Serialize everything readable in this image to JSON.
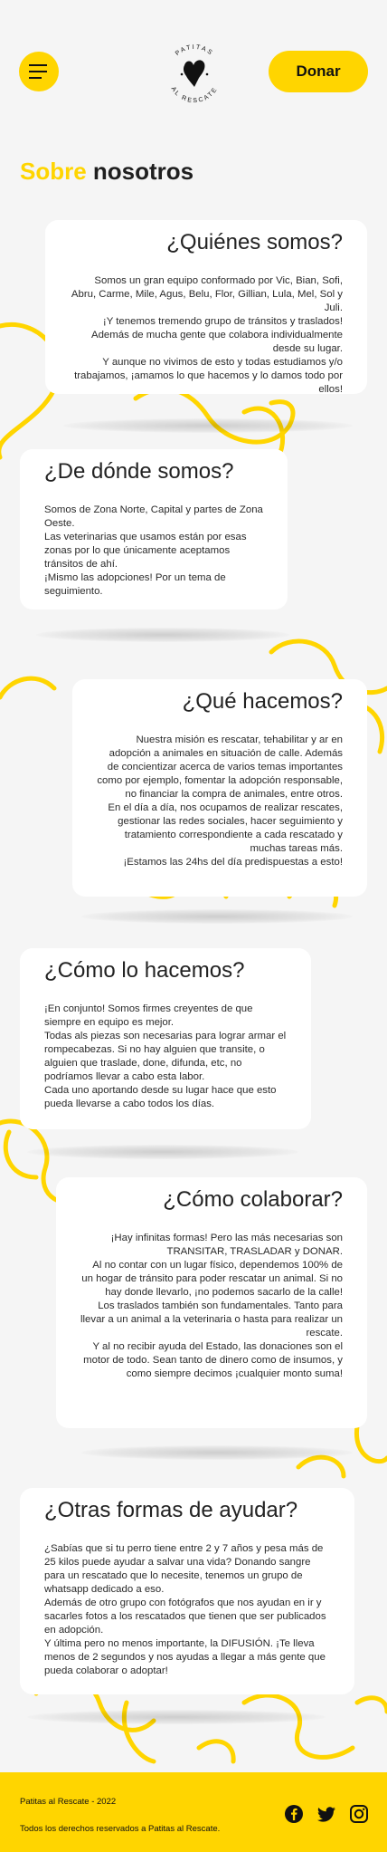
{
  "header": {
    "logo_top": "PATITAS",
    "logo_bottom": "AL RESCATE",
    "donate_label": "Donar"
  },
  "page": {
    "title_accent": "Sobre",
    "title_rest": "nosotros"
  },
  "sections": [
    {
      "title": "¿Quiénes somos?",
      "body": "Somos un gran equipo conformado por Vic, Bian, Sofi, Abru, Carme, Mile, Agus, Belu, Flor, Gillian, Lula, Mel, Sol y Juli.\n¡Y tenemos tremendo grupo de tránsitos y traslados! Además de mucha gente que colabora individualmente desde su lugar.\nY aunque no vivimos de esto y todas estudiamos y/o trabajamos, ¡amamos lo que hacemos y lo damos todo por ellos!"
    },
    {
      "title": "¿De dónde somos?",
      "body": "Somos de Zona Norte, Capital y partes de Zona Oeste.\nLas veterinarias que usamos están por esas zonas por lo que únicamente aceptamos tránsitos de ahí.\n¡Mismo las adopciones! Por un tema de seguimiento."
    },
    {
      "title": "¿Qué hacemos?",
      "body": "Nuestra misión es rescatar, tehabilitar y ar en adopción a animales en situación de calle. Además de concientizar acerca de varios temas importantes como por ejemplo, fomentar la adopción responsable, no financiar la compra de animales, entre otros.\nEn el día a día, nos ocupamos de realizar rescates, gestionar las redes sociales, hacer seguimiento y tratamiento correspondiente a cada rescatado y muchas tareas más.\n¡Estamos las 24hs del día predispuestas a esto!"
    },
    {
      "title": "¿Cómo lo hacemos?",
      "body": "¡En conjunto! Somos firmes creyentes de que siempre en equipo es mejor.\nTodas als piezas son necesarias para lograr armar el rompecabezas. Si no hay alguien que transite, o alguien que traslade, done, difunda, etc, no podríamos llevar a cabo esta labor.\nCada uno aportando desde su lugar hace que esto pueda llevarse a cabo todos los días."
    },
    {
      "title": "¿Cómo colaborar?",
      "body": "¡Hay infinitas formas! Pero las más necesarias son TRANSITAR, TRASLADAR y DONAR.\nAl no contar con un lugar físico, dependemos 100% de un hogar de tránsito para poder rescatar un animal. Si no hay donde llevarlo, ¡no podemos sacarlo de la calle!\nLos traslados también son fundamentales. Tanto para llevar a un animal a la veterinaria o hasta para realizar un rescate.\nY al no recibir ayuda del Estado, las donaciones son el motor de todo. Sean tanto de dinero como de insumos, y como siempre decimos ¡cualquier monto suma!"
    },
    {
      "title": "¿Otras formas de ayudar?",
      "body": "¿Sabías que si tu perro tiene entre 2 y 7 años y pesa más de 25 kilos puede ayudar a salvar una vida? Donando sangre para un rescatado que lo necesite, tenemos un grupo de whatsapp dedicado a eso.\nAdemás de otro grupo con fotógrafos que nos ayudan en ir y sacarles fotos a los rescatados que tienen que ser publicados en adopción.\nY última pero no menos importante, la DIFUSIÓN. ¡Te lleva menos de 2 segundos y nos ayudas a llegar a más gente que pueda colaborar o adoptar!"
    }
  ],
  "footer": {
    "brand": "Patitas al Rescate - 2022",
    "rights": "Todos los derechos reservados a Patitas al Rescate."
  },
  "icons": [
    "menu-icon",
    "logo-icon",
    "facebook-icon",
    "twitter-icon",
    "instagram-icon"
  ],
  "colors": {
    "accent": "#ffd500",
    "background": "#f5f5f5",
    "card": "#ffffff",
    "text": "#2b2b2b"
  }
}
